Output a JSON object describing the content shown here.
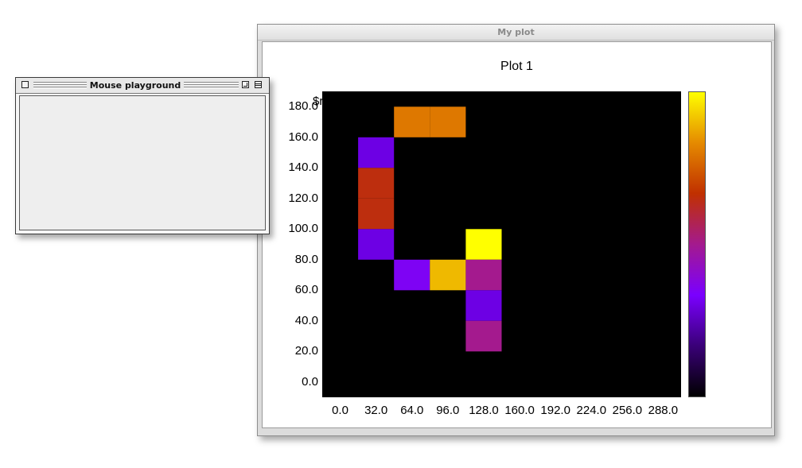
{
  "plot_window": {
    "title": "My plot"
  },
  "mouse_window": {
    "title": "Mouse playground"
  },
  "overlay_text": "$r",
  "chart_data": {
    "type": "heatmap",
    "title": "Plot 1",
    "xlabel": "",
    "ylabel": "",
    "x_ticks": [
      "0.0",
      "32.0",
      "64.0",
      "96.0",
      "128.0",
      "160.0",
      "192.0",
      "224.0",
      "256.0",
      "288.0"
    ],
    "y_ticks": [
      "0.0",
      "20.0",
      "40.0",
      "60.0",
      "80.0",
      "100.0",
      "120.0",
      "140.0",
      "160.0",
      "180.0"
    ],
    "xlim": [
      0,
      320
    ],
    "ylim": [
      -10,
      190
    ],
    "cell_width": 32,
    "cell_height": 20,
    "colormap": "gnuplot",
    "background_value": 0,
    "colormap_stops": [
      "#000000",
      "#3a0078",
      "#7a00ff",
      "#a41a8e",
      "#c03000",
      "#e58a00",
      "#ffff00"
    ],
    "cells": [
      {
        "x": 64,
        "y": 160,
        "value": 0.8
      },
      {
        "x": 96,
        "y": 160,
        "value": 0.8
      },
      {
        "x": 32,
        "y": 140,
        "value": 0.3
      },
      {
        "x": 32,
        "y": 120,
        "value": 0.65
      },
      {
        "x": 32,
        "y": 100,
        "value": 0.65
      },
      {
        "x": 32,
        "y": 80,
        "value": 0.3
      },
      {
        "x": 128,
        "y": 80,
        "value": 1.0
      },
      {
        "x": 64,
        "y": 60,
        "value": 0.35
      },
      {
        "x": 96,
        "y": 60,
        "value": 0.9
      },
      {
        "x": 128,
        "y": 60,
        "value": 0.5
      },
      {
        "x": 128,
        "y": 40,
        "value": 0.3
      },
      {
        "x": 128,
        "y": 20,
        "value": 0.5
      }
    ]
  }
}
